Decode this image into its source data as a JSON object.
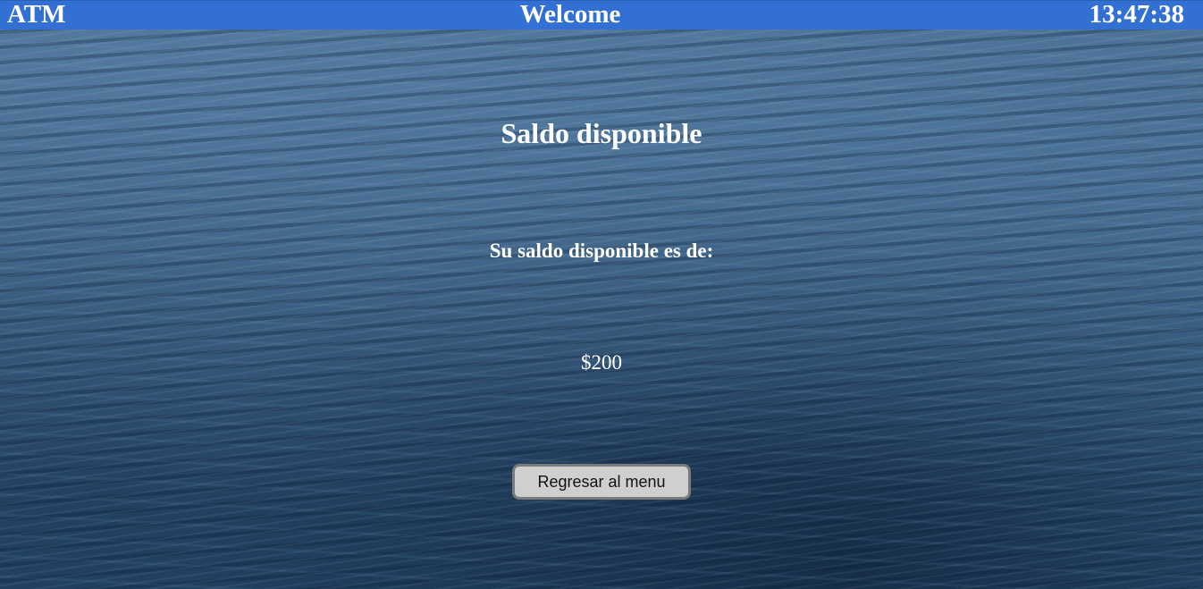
{
  "header": {
    "left_label": "ATM",
    "center_title": "Welcome",
    "clock": "13:47:38"
  },
  "main": {
    "heading": "Saldo disponible",
    "subheading": "Su saldo disponible es de:",
    "amount": "$200",
    "back_button_label": "Regresar al menu"
  },
  "colors": {
    "header_bg": "#3370d4",
    "text": "#ffffff",
    "button_bg": "#cfcfcf",
    "button_border": "#7a7a7a"
  }
}
